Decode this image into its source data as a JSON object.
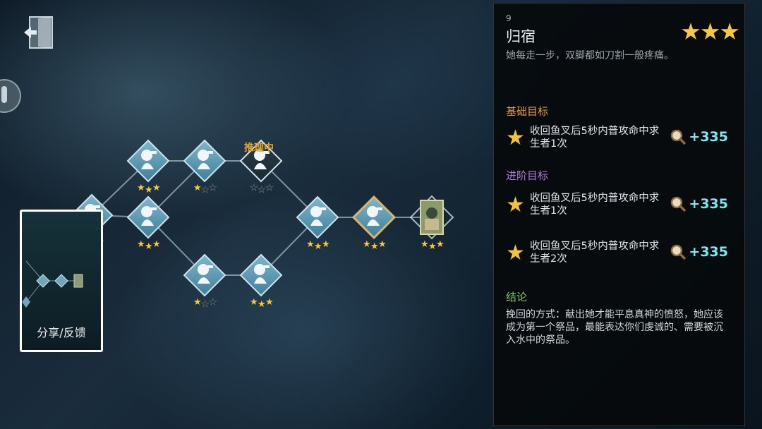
{
  "status": {
    "signal_text": ""
  },
  "map": {
    "tracking_label": "推理中",
    "nodes": [
      {
        "stars": 2,
        "state": "done"
      },
      {
        "stars": 3,
        "state": "done"
      },
      {
        "stars": 3,
        "state": "done"
      },
      {
        "stars": 1,
        "state": "done"
      },
      {
        "stars": 0,
        "state": "current"
      },
      {
        "stars": 1,
        "state": "done"
      },
      {
        "stars": 3,
        "state": "done"
      },
      {
        "stars": 3,
        "state": "done"
      },
      {
        "stars": 3,
        "state": "done"
      },
      {
        "stars": 3,
        "state": "selected"
      },
      {
        "stars": 3,
        "state": "final"
      }
    ]
  },
  "share": {
    "label": "分享/反馈"
  },
  "chapter": {
    "number": "9",
    "title": "归宿",
    "stars_display": "★★★",
    "description": "她每走一步，双脚都如刀割一般疼痛。"
  },
  "sections": {
    "basic": "基础目标",
    "advanced": "进阶目标",
    "conclusion": "结论"
  },
  "goals": {
    "basic": [
      {
        "line1": "收回鱼叉后5秒内普攻命中求",
        "line2": "生者1次",
        "reward": "+335"
      }
    ],
    "advanced": [
      {
        "line1": "收回鱼叉后5秒内普攻命中求",
        "line2": "生者1次",
        "reward": "+335"
      },
      {
        "line1": "收回鱼叉后5秒内普攻命中求",
        "line2": "生者2次",
        "reward": "+335"
      }
    ]
  },
  "conclusion_text": "挽回的方式：献出她才能平息真神的愤怒，她应该成为第一个祭品，最能表达你们虔诚的、需要被沉入水中的祭品。",
  "colors": {
    "star": "#f5c842",
    "reward": "#7ee8ee",
    "basic_label": "#e29a3a",
    "advanced_label": "#b07ad8",
    "conclusion_label": "#7ec86a"
  }
}
